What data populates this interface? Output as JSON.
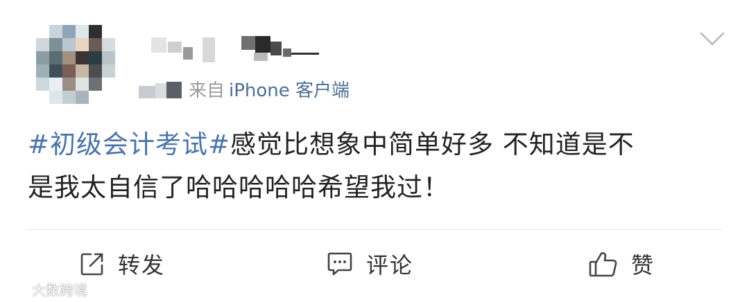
{
  "header": {
    "source_prefix": "来自",
    "source_client": "iPhone 客户端",
    "menu_icon": "chevron-down-icon"
  },
  "post": {
    "hashtag": "#初级会计考试#",
    "text_line1": "感觉比想象中简单好多 不知道是不",
    "text_line2": "是我太自信了哈哈哈哈哈希望我过！"
  },
  "actions": {
    "repost_label": "转发",
    "comment_label": "评论",
    "like_label": "赞",
    "repost_icon": "share-icon",
    "comment_icon": "comment-icon",
    "like_icon": "thumbs-up-icon"
  },
  "watermark": {
    "text": "大数跨境",
    "icon": "wechat-logo-icon"
  },
  "colors": {
    "hashtag": "#4a74a8",
    "source_link": "#4c6e93",
    "text": "#222222",
    "muted": "#9a9a9a",
    "divider": "#e6e6e6"
  }
}
